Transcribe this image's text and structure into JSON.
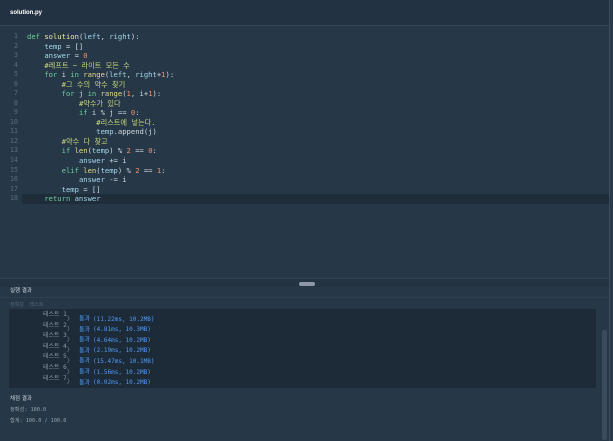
{
  "editor": {
    "tab_title": "solution.py",
    "active_line": 18,
    "lines": [
      {
        "n": "1",
        "tokens": [
          {
            "t": "def",
            "c": "#6ccf9b"
          },
          {
            "t": " "
          },
          {
            "t": "solution",
            "c": "#f3e8a9"
          },
          {
            "t": "("
          },
          {
            "t": "left",
            "c": "#a5d8ea"
          },
          {
            "t": ", "
          },
          {
            "t": "right",
            "c": "#a5d8ea"
          },
          {
            "t": "):"
          }
        ]
      },
      {
        "n": "2",
        "tokens": [
          {
            "t": "    "
          },
          {
            "t": "temp",
            "c": "#a5d8ea"
          },
          {
            "t": " = []"
          }
        ]
      },
      {
        "n": "3",
        "tokens": [
          {
            "t": "    "
          },
          {
            "t": "answer",
            "c": "#a5d8ea"
          },
          {
            "t": " = "
          },
          {
            "t": "0",
            "c": "#f4916a"
          }
        ]
      },
      {
        "n": "4",
        "tokens": [
          {
            "t": "    "
          },
          {
            "t": "#레프트 ~ 라이트 모든 수",
            "c": "#c5d57c"
          }
        ]
      },
      {
        "n": "5",
        "tokens": [
          {
            "t": "    "
          },
          {
            "t": "for",
            "c": "#6ccf9b"
          },
          {
            "t": " i "
          },
          {
            "t": "in",
            "c": "#6ccf9b"
          },
          {
            "t": " "
          },
          {
            "t": "range",
            "c": "#e8d98a"
          },
          {
            "t": "("
          },
          {
            "t": "left",
            "c": "#a5d8ea"
          },
          {
            "t": ", "
          },
          {
            "t": "right",
            "c": "#a5d8ea"
          },
          {
            "t": "+"
          },
          {
            "t": "1",
            "c": "#f4916a"
          },
          {
            "t": "):"
          }
        ]
      },
      {
        "n": "6",
        "tokens": [
          {
            "t": "        "
          },
          {
            "t": "#그 수의 약수 찾기",
            "c": "#c5d57c"
          }
        ]
      },
      {
        "n": "7",
        "tokens": [
          {
            "t": "        "
          },
          {
            "t": "for",
            "c": "#6ccf9b"
          },
          {
            "t": " j "
          },
          {
            "t": "in",
            "c": "#6ccf9b"
          },
          {
            "t": " "
          },
          {
            "t": "range",
            "c": "#e8d98a"
          },
          {
            "t": "("
          },
          {
            "t": "1",
            "c": "#f4916a"
          },
          {
            "t": ", i+"
          },
          {
            "t": "1",
            "c": "#f4916a"
          },
          {
            "t": "):"
          }
        ]
      },
      {
        "n": "8",
        "tokens": [
          {
            "t": "            "
          },
          {
            "t": "#약수가 있다",
            "c": "#c5d57c"
          }
        ]
      },
      {
        "n": "9",
        "tokens": [
          {
            "t": "            "
          },
          {
            "t": "if",
            "c": "#6ccf9b"
          },
          {
            "t": " i % j == "
          },
          {
            "t": "0",
            "c": "#f4916a"
          },
          {
            "t": ":"
          }
        ]
      },
      {
        "n": "10",
        "tokens": [
          {
            "t": "                "
          },
          {
            "t": "#리스트에 넣는다.",
            "c": "#c5d57c"
          }
        ]
      },
      {
        "n": "11",
        "tokens": [
          {
            "t": "                "
          },
          {
            "t": "temp",
            "c": "#a5d8ea"
          },
          {
            "t": ".append(j)"
          }
        ]
      },
      {
        "n": "12",
        "tokens": [
          {
            "t": "        "
          },
          {
            "t": "#약수 다 찾고",
            "c": "#c5d57c"
          }
        ]
      },
      {
        "n": "13",
        "tokens": [
          {
            "t": "        "
          },
          {
            "t": "if",
            "c": "#6ccf9b"
          },
          {
            "t": " "
          },
          {
            "t": "len",
            "c": "#e8d98a"
          },
          {
            "t": "("
          },
          {
            "t": "temp",
            "c": "#a5d8ea"
          },
          {
            "t": ") % "
          },
          {
            "t": "2",
            "c": "#f4916a"
          },
          {
            "t": " == "
          },
          {
            "t": "0",
            "c": "#f4916a"
          },
          {
            "t": ":"
          }
        ]
      },
      {
        "n": "14",
        "tokens": [
          {
            "t": "            "
          },
          {
            "t": "answer",
            "c": "#a5d8ea"
          },
          {
            "t": " += i"
          }
        ]
      },
      {
        "n": "15",
        "tokens": [
          {
            "t": "        "
          },
          {
            "t": "elif",
            "c": "#6ccf9b"
          },
          {
            "t": " "
          },
          {
            "t": "len",
            "c": "#e8d98a"
          },
          {
            "t": "("
          },
          {
            "t": "temp",
            "c": "#a5d8ea"
          },
          {
            "t": ") % "
          },
          {
            "t": "2",
            "c": "#f4916a"
          },
          {
            "t": " == "
          },
          {
            "t": "1",
            "c": "#f4916a"
          },
          {
            "t": ":"
          }
        ]
      },
      {
        "n": "16",
        "tokens": [
          {
            "t": "            "
          },
          {
            "t": "answer",
            "c": "#a5d8ea"
          },
          {
            "t": " -= i"
          }
        ]
      },
      {
        "n": "17",
        "tokens": [
          {
            "t": "        "
          },
          {
            "t": "temp",
            "c": "#a5d8ea"
          },
          {
            "t": " = []"
          }
        ]
      },
      {
        "n": "18",
        "tokens": [
          {
            "t": "    "
          },
          {
            "t": "return",
            "c": "#6ccf9b"
          },
          {
            "t": " "
          },
          {
            "t": "answer",
            "c": "#a5d8ea"
          }
        ]
      }
    ]
  },
  "output": {
    "title": "실행 결과",
    "section_label": "정확성  테스트",
    "tests": [
      {
        "label": "테스트 1",
        "sep": "〉",
        "result": "통과",
        "detail": "(11.22ms, 10.2MB)"
      },
      {
        "label": "테스트 2",
        "sep": "〉",
        "result": "통과",
        "detail": "(4.81ms, 10.3MB)"
      },
      {
        "label": "테스트 3",
        "sep": "〉",
        "result": "통과",
        "detail": "(4.64ms, 10.2MB)"
      },
      {
        "label": "테스트 4",
        "sep": "〉",
        "result": "통과",
        "detail": "(2.19ms, 10.2MB)"
      },
      {
        "label": "테스트 5",
        "sep": "〉",
        "result": "통과",
        "detail": "(15.47ms, 10.1MB)"
      },
      {
        "label": "테스트 6",
        "sep": "〉",
        "result": "통과",
        "detail": "(1.56ms, 10.2MB)"
      },
      {
        "label": "테스트 7",
        "sep": "〉",
        "result": "통과",
        "detail": "(0.02ms, 10.2MB)"
      }
    ],
    "summary_title": "채점 결과",
    "accuracy": "정확성: 100.0",
    "total": "합계: 100.0 / 100.0"
  },
  "colors": {
    "pass": "#4f9cf7"
  }
}
